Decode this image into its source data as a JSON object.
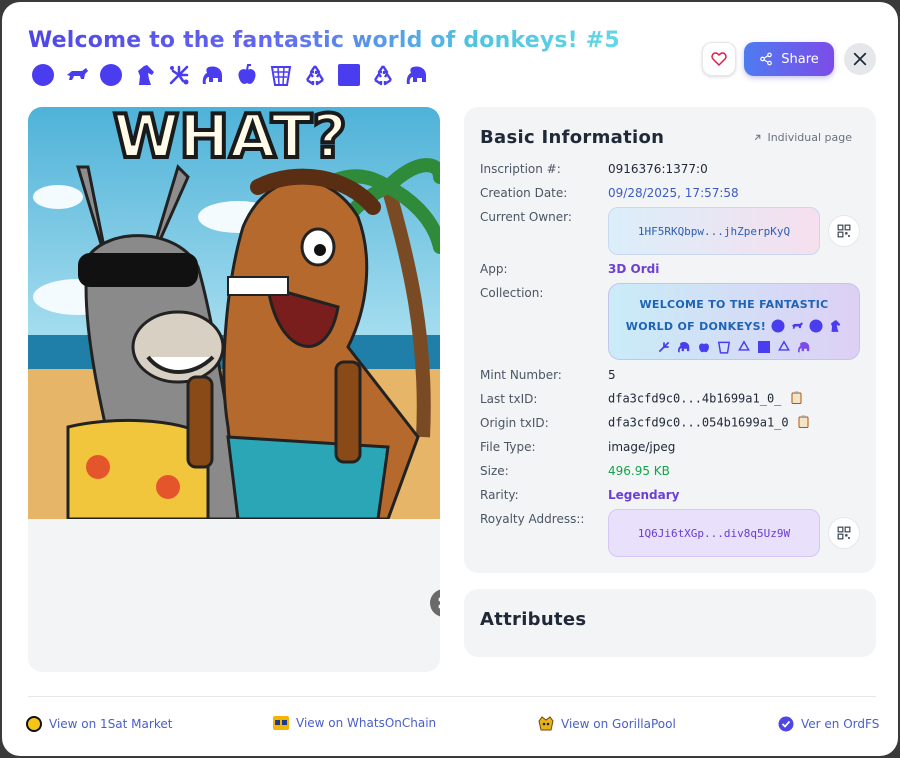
{
  "header": {
    "title": "Welcome to the fantastic world of donkeys! #5",
    "emojis": [
      "blue-circle",
      "bull",
      "blue-circle",
      "horse-head",
      "fireworks",
      "elephant",
      "apple",
      "wastebasket",
      "recycle",
      "blue-square",
      "recycle",
      "elephant"
    ],
    "share_label": "Share"
  },
  "basic_info": {
    "title": "Basic Information",
    "individual_page": "Individual page",
    "rows": {
      "inscription": {
        "label": "Inscription #:",
        "value": "0916376:1377:0"
      },
      "creation_date": {
        "label": "Creation Date:",
        "value": "09/28/2025, 17:57:58"
      },
      "current_owner": {
        "label": "Current Owner:",
        "value": "1HF5RKQbpw...jhZperpKyQ"
      },
      "app": {
        "label": "App:",
        "value": "3D Ordi"
      },
      "collection": {
        "label": "Collection:",
        "value": "WELCOME TO THE FANTASTIC WORLD OF DONKEYS!"
      },
      "mint_number": {
        "label": "Mint Number:",
        "value": "5"
      },
      "last_txid": {
        "label": "Last txID:",
        "value": "dfa3cfd9c0...4b1699a1_0_"
      },
      "origin_txid": {
        "label": "Origin txID:",
        "value": "dfa3cfd9c0...054b1699a1_0"
      },
      "file_type": {
        "label": "File Type:",
        "value": "image/jpeg"
      },
      "size": {
        "label": "Size:",
        "value": "496.95 KB"
      },
      "rarity": {
        "label": "Rarity:",
        "value": "Legendary"
      },
      "royalty": {
        "label": "Royalty Address::",
        "value": "1Q6Ji6tXGp...div8q5Uz9W"
      }
    }
  },
  "attributes": {
    "title": "Attributes"
  },
  "image": {
    "caption": "WHAT?"
  },
  "footer": {
    "links": [
      "View on 1Sat Market",
      "View on WhatsOnChain",
      "View on GorillaPool",
      "Ver en OrdFS"
    ]
  },
  "colors": {
    "accent_blue": "#4f7bf0",
    "accent_purple": "#7c4ce8",
    "link": "#4a5ec9",
    "rarity": "#6d3fd6",
    "size_green": "#16a34a"
  }
}
